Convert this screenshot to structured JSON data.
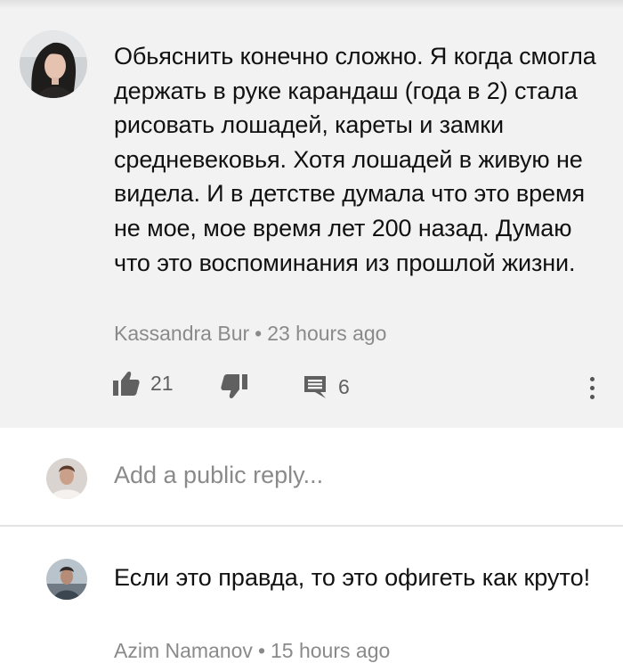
{
  "comment": {
    "text": "Обьяснить конечно сложно. Я когда смогла держать в руке карандаш (года в 2) стала рисовать лошадей, кареты и замки средневековья. Хотя лошадей в живую не видела. И в детстве думала что это время не мое, мое время лет 200 назад. Думаю что это воспоминания из прошлой жизни.",
    "author": "Kassandra Bur",
    "separator": "•",
    "time": "23 hours ago",
    "likes": "21",
    "replies": "6"
  },
  "reply_box": {
    "placeholder": "Add a public reply..."
  },
  "next_comment": {
    "text": "Если это правда, то это офигеть как круто!",
    "author": "Azim Namanov",
    "separator": "•",
    "time": "15 hours ago"
  },
  "icons": {
    "like": "thumbs-up-icon",
    "dislike": "thumbs-down-icon",
    "reply": "comment-icon",
    "more": "vertical-dots-icon"
  },
  "colors": {
    "comment_background": "#f2f2f2",
    "icon": "#606060",
    "meta_text": "#8a8a8a"
  }
}
